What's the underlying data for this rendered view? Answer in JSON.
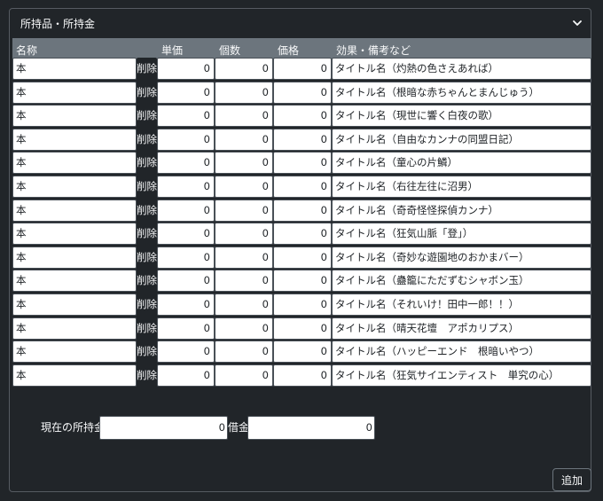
{
  "panel": {
    "title": "所持品・所持金"
  },
  "headers": {
    "name": "名称",
    "unit_price": "単価",
    "quantity": "個数",
    "price": "価格",
    "notes": "効果・備考など"
  },
  "rows": [
    {
      "name": "本",
      "delete": "削除",
      "unit_price": "0",
      "quantity": "0",
      "price": "0",
      "notes": "タイトル名（灼熱の色さえあれば）"
    },
    {
      "name": "本",
      "delete": "削除",
      "unit_price": "0",
      "quantity": "0",
      "price": "0",
      "notes": "タイトル名（根暗な赤ちゃんとまんじゅう）"
    },
    {
      "name": "本",
      "delete": "削除",
      "unit_price": "0",
      "quantity": "0",
      "price": "0",
      "notes": "タイトル名（現世に響く白夜の歌）"
    },
    {
      "name": "本",
      "delete": "削除",
      "unit_price": "0",
      "quantity": "0",
      "price": "0",
      "notes": "タイトル名（自由なカンナの同盟日記）"
    },
    {
      "name": "本",
      "delete": "削除",
      "unit_price": "0",
      "quantity": "0",
      "price": "0",
      "notes": "タイトル名（童心の片鱗）"
    },
    {
      "name": "本",
      "delete": "削除",
      "unit_price": "0",
      "quantity": "0",
      "price": "0",
      "notes": "タイトル名（右往左往に沼男）"
    },
    {
      "name": "本",
      "delete": "削除",
      "unit_price": "0",
      "quantity": "0",
      "price": "0",
      "notes": "タイトル名（奇奇怪怪探偵カンナ）"
    },
    {
      "name": "本",
      "delete": "削除",
      "unit_price": "0",
      "quantity": "0",
      "price": "0",
      "notes": "タイトル名（狂気山脈「登」）"
    },
    {
      "name": "本",
      "delete": "削除",
      "unit_price": "0",
      "quantity": "0",
      "price": "0",
      "notes": "タイトル名（奇妙な遊園地のおかまバー）"
    },
    {
      "name": "本",
      "delete": "削除",
      "unit_price": "0",
      "quantity": "0",
      "price": "0",
      "notes": "タイトル名（蠱籠にただずむシャボン玉）"
    },
    {
      "name": "本",
      "delete": "削除",
      "unit_price": "0",
      "quantity": "0",
      "price": "0",
      "notes": "タイトル名（それいけ！田中一郎！！）"
    },
    {
      "name": "本",
      "delete": "削除",
      "unit_price": "0",
      "quantity": "0",
      "price": "0",
      "notes": "タイトル名（晴天花壇　アポカリプス）"
    },
    {
      "name": "本",
      "delete": "削除",
      "unit_price": "0",
      "quantity": "0",
      "price": "0",
      "notes": "タイトル名（ハッピーエンド　根暗いやつ）"
    },
    {
      "name": "本",
      "delete": "削除",
      "unit_price": "0",
      "quantity": "0",
      "price": "0",
      "notes": "タイトル名（狂気サイエンティスト　単究の心）"
    }
  ],
  "money": {
    "current_label": "現在の所持金",
    "current_value": "0",
    "debt_label": "借金",
    "debt_value": "0"
  },
  "add_button": "追加",
  "icons": {
    "collapse": "chevron-down-icon"
  },
  "colors": {
    "background": "#212529",
    "header_bar": "#6c757d",
    "border": "#565b62",
    "cell": "#ffffff"
  }
}
